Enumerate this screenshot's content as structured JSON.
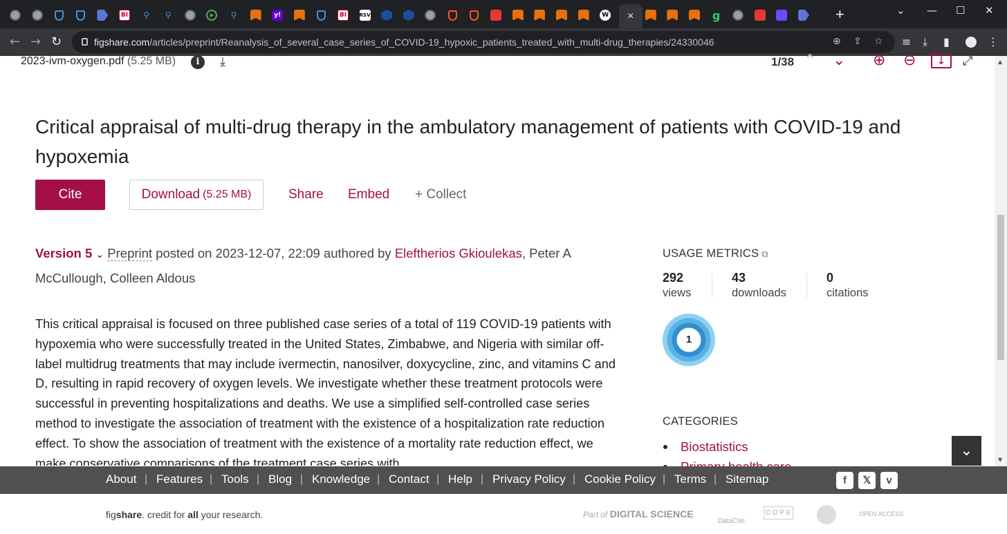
{
  "browser": {
    "url_host": "figshare.com",
    "url_path": "/articles/preprint/Reanalysis_of_several_case_series_of_COVID-19_hypoxic_patients_treated_with_multi-drug_therapies/24330046",
    "active_tab_close": "×",
    "new_tab": "+",
    "favicons": [
      "globe",
      "globe",
      "shield",
      "shield",
      "arrow",
      "bi",
      "search",
      "search",
      "globe",
      "play",
      "search",
      "book",
      "yahoo",
      "book",
      "shield",
      "bi",
      "rsv",
      "cube",
      "cube",
      "globe",
      "brave",
      "brave",
      "red",
      "book",
      "book",
      "book",
      "book",
      "w",
      "active",
      "book",
      "book",
      "book",
      "g",
      "globe",
      "red",
      "proton",
      "arrow"
    ],
    "favicon_text": {
      "bi": "BI",
      "rsv": "RSV",
      "yahoo": "y!",
      "w": "W",
      "g": "g",
      "search": "⚲",
      "play": "▶"
    }
  },
  "pdf": {
    "filename": "2023-ivm-oxygen.pdf",
    "size": "(5.25 MB)",
    "info": "i",
    "page_indicator": "1/38"
  },
  "article": {
    "title": "Critical appraisal of multi-drug therapy in the ambulatory management of patients with COVID-19 and hypoxemia",
    "cite_label": "Cite",
    "download_label": "Download",
    "download_size": "(5.25 MB)",
    "share_label": "Share",
    "embed_label": "Embed",
    "collect_label": "+ Collect",
    "version": "Version 5",
    "item_type": "Preprint",
    "posted_text": "posted on 2023-12-07, 22:09 authored by",
    "first_author": "Eleftherios Gkioulekas",
    "other_authors": ", Peter A McCullough, Colleen Aldous",
    "abstract": "This critical appraisal is focused on three published case series of a total of 119 COVID-19 patients with hypoxemia who were successfully treated in the United States, Zimbabwe, and Nigeria with similar off-label multidrug treatments that may include ivermectin, nanosilver, doxycycline, zinc, and vitamins C and D, resulting in rapid recovery of oxygen levels. We investigate whether these treatment protocols were successful in preventing hospitalizations and deaths. We use a simplified self-controlled case series method to investigate the association of treatment with the existence of a hospitalization rate reduction effect. To show the association of treatment with the existence of a mortality rate reduction effect, we make conservative comparisons of the treatment case series with"
  },
  "sidebar": {
    "usage_heading": "USAGE METRICS",
    "metrics": [
      {
        "value": "292",
        "label": "views"
      },
      {
        "value": "43",
        "label": "downloads"
      },
      {
        "value": "0",
        "label": "citations"
      }
    ],
    "altmetric_score": "1",
    "categories_heading": "CATEGORIES",
    "categories": [
      "Biostatistics",
      "Primary health care"
    ]
  },
  "footer": {
    "links": [
      "About",
      "Features",
      "Tools",
      "Blog",
      "Knowledge",
      "Contact",
      "Help",
      "Privacy Policy",
      "Cookie Policy",
      "Terms",
      "Sitemap"
    ],
    "social": [
      "f",
      "𝕏",
      "v"
    ],
    "credit_pre": "fig",
    "credit_brand": "share",
    "credit_mid": ". credit for ",
    "credit_all": "all",
    "credit_post": " your research.",
    "partners": {
      "digital_science_pre": "Part of",
      "digital_science": "DIGITAL SCIENCE",
      "datacite": "DataCite",
      "cope": "C O P E",
      "open_access": "OPEN ACCESS"
    }
  },
  "colors": {
    "accent": "#a50f48",
    "footer_bg": "#505050",
    "chrome_bg": "#202124"
  }
}
